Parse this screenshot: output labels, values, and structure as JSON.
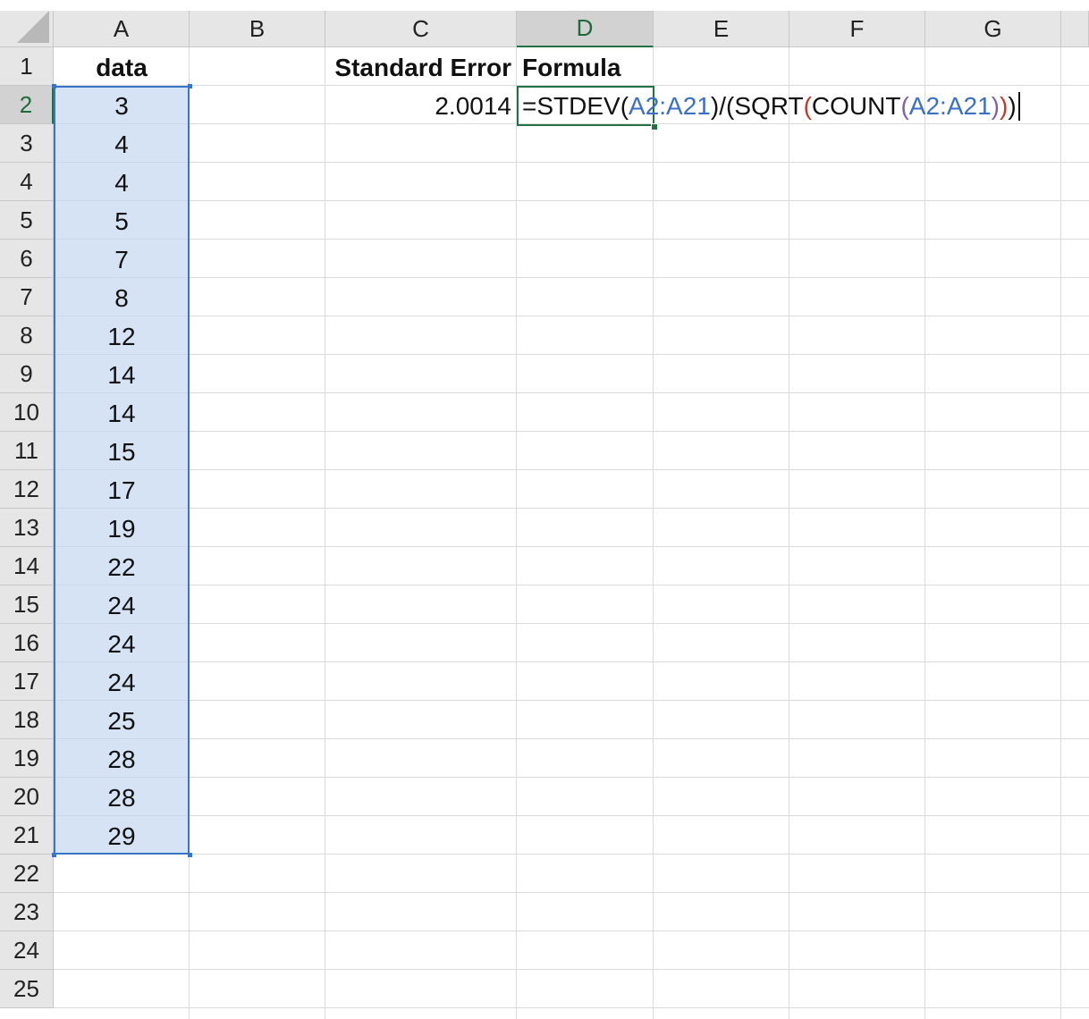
{
  "columns": [
    "A",
    "B",
    "C",
    "D",
    "E",
    "F",
    "G"
  ],
  "rows": [
    "1",
    "2",
    "3",
    "4",
    "5",
    "6",
    "7",
    "8",
    "9",
    "10",
    "11",
    "12",
    "13",
    "14",
    "15",
    "16",
    "17",
    "18",
    "19",
    "20",
    "21",
    "22",
    "23",
    "24",
    "25"
  ],
  "active_column": "D",
  "active_row": "2",
  "column_a": {
    "header": "data",
    "values": [
      "3",
      "4",
      "4",
      "5",
      "7",
      "8",
      "12",
      "14",
      "14",
      "15",
      "17",
      "19",
      "22",
      "24",
      "24",
      "24",
      "25",
      "28",
      "28",
      "29"
    ]
  },
  "column_c": {
    "header": "Standard Error",
    "value": "2.0014"
  },
  "column_d": {
    "header": "Formula"
  },
  "formula": {
    "parts": [
      {
        "text": "=STDEV(",
        "color": "#111111"
      },
      {
        "text": "A2:A21",
        "color": "#3a6fc4"
      },
      {
        "text": ")/(SQRT",
        "color": "#111111"
      },
      {
        "text": "(",
        "color": "#c0392b"
      },
      {
        "text": "COUNT",
        "color": "#111111"
      },
      {
        "text": "(",
        "color": "#7b5fb3"
      },
      {
        "text": "A2:A21",
        "color": "#3a6fc4"
      },
      {
        "text": ")",
        "color": "#7b5fb3"
      },
      {
        "text": ")",
        "color": "#c0392b"
      },
      {
        "text": ")",
        "color": "#111111"
      }
    ]
  },
  "colors": {
    "selection_fill": "#c4d7f0",
    "selection_border": "#3a74c4",
    "active_cell_border": "#217346",
    "header_bg": "#e6e6e6"
  }
}
